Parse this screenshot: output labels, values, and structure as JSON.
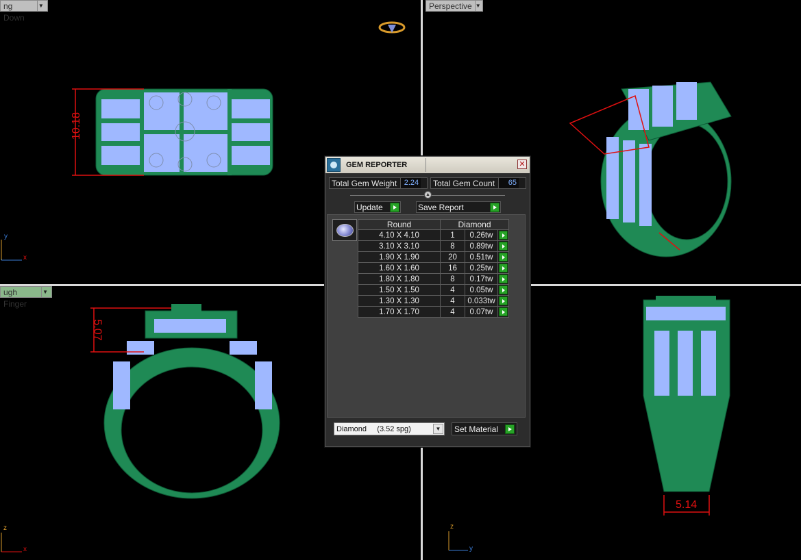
{
  "viewports": {
    "top_left": {
      "label": "ng Down"
    },
    "top_right": {
      "label": "Perspective"
    },
    "bottom_left": {
      "label": "ugh Finger"
    }
  },
  "dimensions": {
    "top_view_height": "10.18",
    "front_view_height": "5.07",
    "side_view_width": "5.14"
  },
  "axes": {
    "top_left": {
      "a": "y",
      "b": "x"
    },
    "bottom_left": {
      "a": "z",
      "b": "x"
    },
    "bottom_right": {
      "a": "z",
      "b": "y"
    }
  },
  "gem_reporter": {
    "title": "GEM REPORTER",
    "total_gem_weight_label": "Total Gem Weight",
    "total_gem_weight": "2.24",
    "total_gem_count_label": "Total Gem Count",
    "total_gem_count": "65",
    "update_label": "Update",
    "save_report_label": "Save Report",
    "table": {
      "headers": [
        "Round",
        "Diamond"
      ],
      "rows": [
        {
          "size": "4.10 X 4.10",
          "count": "1",
          "weight": "0.26tw"
        },
        {
          "size": "3.10 X 3.10",
          "count": "8",
          "weight": "0.89tw"
        },
        {
          "size": "1.90 X 1.90",
          "count": "20",
          "weight": "0.51tw"
        },
        {
          "size": "1.60 X 1.60",
          "count": "16",
          "weight": "0.25tw"
        },
        {
          "size": "1.80 X 1.80",
          "count": "8",
          "weight": "0.17tw"
        },
        {
          "size": "1.50 X 1.50",
          "count": "4",
          "weight": "0.05tw"
        },
        {
          "size": "1.30 X 1.30",
          "count": "4",
          "weight": "0.033tw"
        },
        {
          "size": "1.70 X 1.70",
          "count": "4",
          "weight": "0.07tw"
        }
      ]
    },
    "material_select": "Diamond     (3.52 spg)",
    "set_material_label": "Set Material"
  },
  "colors": {
    "metal": "#1f8a55",
    "gem": "#9fb8ff",
    "dimension": "#e01010"
  }
}
